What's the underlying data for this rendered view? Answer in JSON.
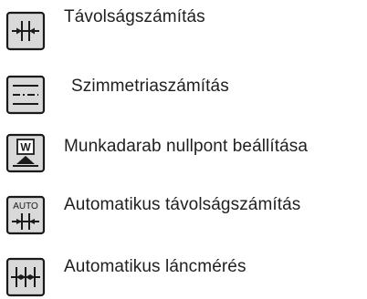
{
  "menu": {
    "items": [
      {
        "label": "Távolságszámítás",
        "icon": "distance-calc-icon"
      },
      {
        "label": "Szimmetriaszámítás",
        "icon": "symmetry-calc-icon"
      },
      {
        "label": "Munkadarab nullpont beállítása",
        "icon": "workpiece-zero-icon"
      },
      {
        "label": "Automatikus távolságszámítás",
        "icon": "auto-distance-calc-icon"
      },
      {
        "label": "Automatikus láncmérés",
        "icon": "auto-chain-measure-icon"
      }
    ],
    "auto_badge": "AUTO",
    "workpiece_letter": "W"
  },
  "colors": {
    "icon_border": "#1a1a1a",
    "icon_fill": "#d9d9d9",
    "text": "#1f1f1f"
  }
}
